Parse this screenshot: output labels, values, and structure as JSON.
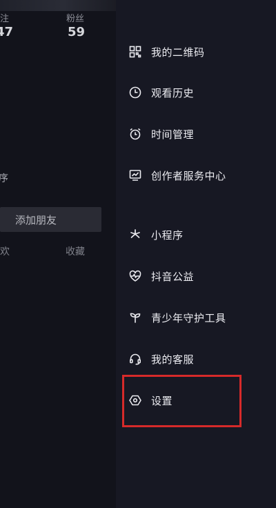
{
  "profile": {
    "stats": [
      {
        "label": "注",
        "value": "47"
      },
      {
        "label": "粉丝",
        "value": "59"
      }
    ],
    "partial_text": "序",
    "add_friend_label": "添加朋友",
    "tabs": [
      {
        "label": "欢"
      },
      {
        "label": "收藏"
      }
    ]
  },
  "drawer": {
    "items": [
      {
        "label": "我的二维码",
        "icon": "qr-code-icon"
      },
      {
        "label": "观看历史",
        "icon": "clock-icon"
      },
      {
        "label": "时间管理",
        "icon": "alarm-clock-icon"
      },
      {
        "label": "创作者服务中心",
        "icon": "creator-chart-icon"
      },
      {
        "label": "小程序",
        "icon": "mini-program-icon"
      },
      {
        "label": "抖音公益",
        "icon": "heart-pulse-icon"
      },
      {
        "label": "青少年守护工具",
        "icon": "sprout-icon"
      },
      {
        "label": "我的客服",
        "icon": "headset-icon"
      },
      {
        "label": "设置",
        "icon": "settings-hexagon-icon"
      }
    ]
  },
  "colors": {
    "background": "#161722",
    "highlight": "#d72a2a"
  }
}
